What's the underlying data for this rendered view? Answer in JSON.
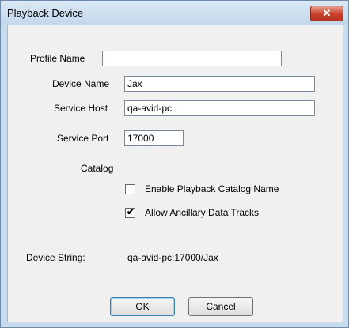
{
  "window": {
    "title": "Playback Device",
    "close_glyph": "✕"
  },
  "form": {
    "profile_name": {
      "label": "Profile Name",
      "value": ""
    },
    "device_name": {
      "label": "Device Name",
      "value": "Jax"
    },
    "service_host": {
      "label": "Service Host",
      "value": "qa-avid-pc"
    },
    "service_port": {
      "label": "Service Port",
      "value": "17000"
    }
  },
  "catalog": {
    "heading": "Catalog",
    "enable_playback_catalog_name": {
      "label": "Enable Playback Catalog Name",
      "checked": false
    },
    "allow_ancillary_data_tracks": {
      "label": "Allow Ancillary Data Tracks",
      "checked": true
    }
  },
  "device_string": {
    "label": "Device String:",
    "value": "qa-avid-pc:17000/Jax"
  },
  "buttons": {
    "ok": "OK",
    "cancel": "Cancel"
  },
  "icons": {
    "close": "close-icon",
    "check": "checkmark-icon"
  }
}
